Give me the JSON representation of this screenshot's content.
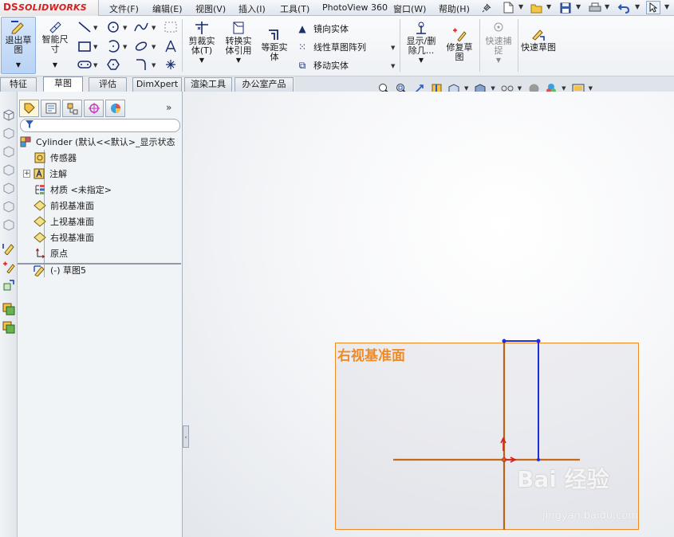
{
  "app": {
    "brand_mark": "DS",
    "brand_name": "SOLIDWORKS"
  },
  "menu": [
    "文件(F)",
    "编辑(E)",
    "视图(V)",
    "插入(I)",
    "工具(T)",
    "PhotoView 360",
    "窗口(W)",
    "帮助(H)"
  ],
  "commands": {
    "exit_sketch": "退出草图",
    "smart_dimension": "智能尺寸",
    "trim": "剪裁实体(T)",
    "convert": "转换实体引用",
    "offset": "等距实体",
    "mirror": "镜向实体",
    "linear_pattern": "线性草图阵列",
    "move": "移动实体",
    "display_delete": "显示/删除几...",
    "repair": "修复草图",
    "quick_snap": "快速捕捉",
    "rapid_sketch": "快速草图"
  },
  "tabs": [
    "特征",
    "草图",
    "评估",
    "DimXpert",
    "渲染工具",
    "办公室产品"
  ],
  "active_tab": "草图",
  "tree": {
    "root": "Cylinder  (默认<<默认>_显示状态",
    "items": [
      {
        "label": "传感器",
        "icon": "sensor-icon"
      },
      {
        "label": "注解",
        "icon": "annotation-icon",
        "expandable": true
      },
      {
        "label": "材质 <未指定>",
        "icon": "material-icon"
      },
      {
        "label": "前视基准面",
        "icon": "plane-icon"
      },
      {
        "label": "上视基准面",
        "icon": "plane-icon"
      },
      {
        "label": "右视基准面",
        "icon": "plane-icon"
      },
      {
        "label": "原点",
        "icon": "origin-icon"
      }
    ],
    "sketch": "(-) 草图5"
  },
  "graphics": {
    "plane_label": "右视基准面",
    "watermark": "Bai 经验",
    "watermark_sub": "jingyan.baidu.com"
  },
  "colors": {
    "plane": "#f08a24",
    "sketch_blue": "#1a2fe0",
    "axis": "#c46a1a",
    "brand_red": "#d42020"
  }
}
